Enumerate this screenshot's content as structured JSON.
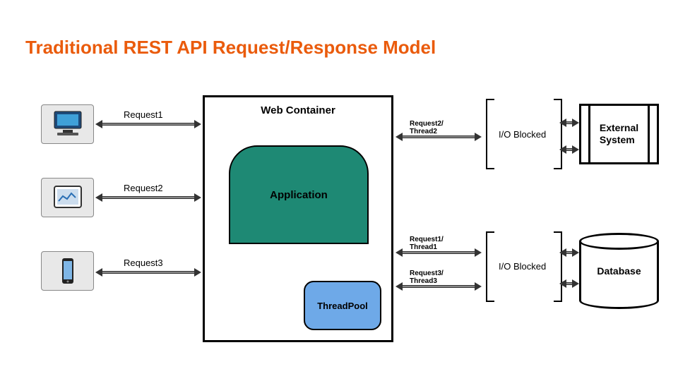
{
  "title": "Traditional REST API Request/Response Model",
  "clients": {
    "c1": {
      "label": "Request1"
    },
    "c2": {
      "label": "Request2"
    },
    "c3": {
      "label": "Request3"
    }
  },
  "container": {
    "title": "Web Container",
    "application": "Application",
    "threadpool": "ThreadPool"
  },
  "threads": {
    "t1": "Request2/\nThread2",
    "t2": "Request1/\nThread1",
    "t3": "Request3/\nThread3"
  },
  "io": {
    "top": "I/O Blocked",
    "bottom": "I/O Blocked"
  },
  "external": "External\nSystem",
  "database": "Database"
}
